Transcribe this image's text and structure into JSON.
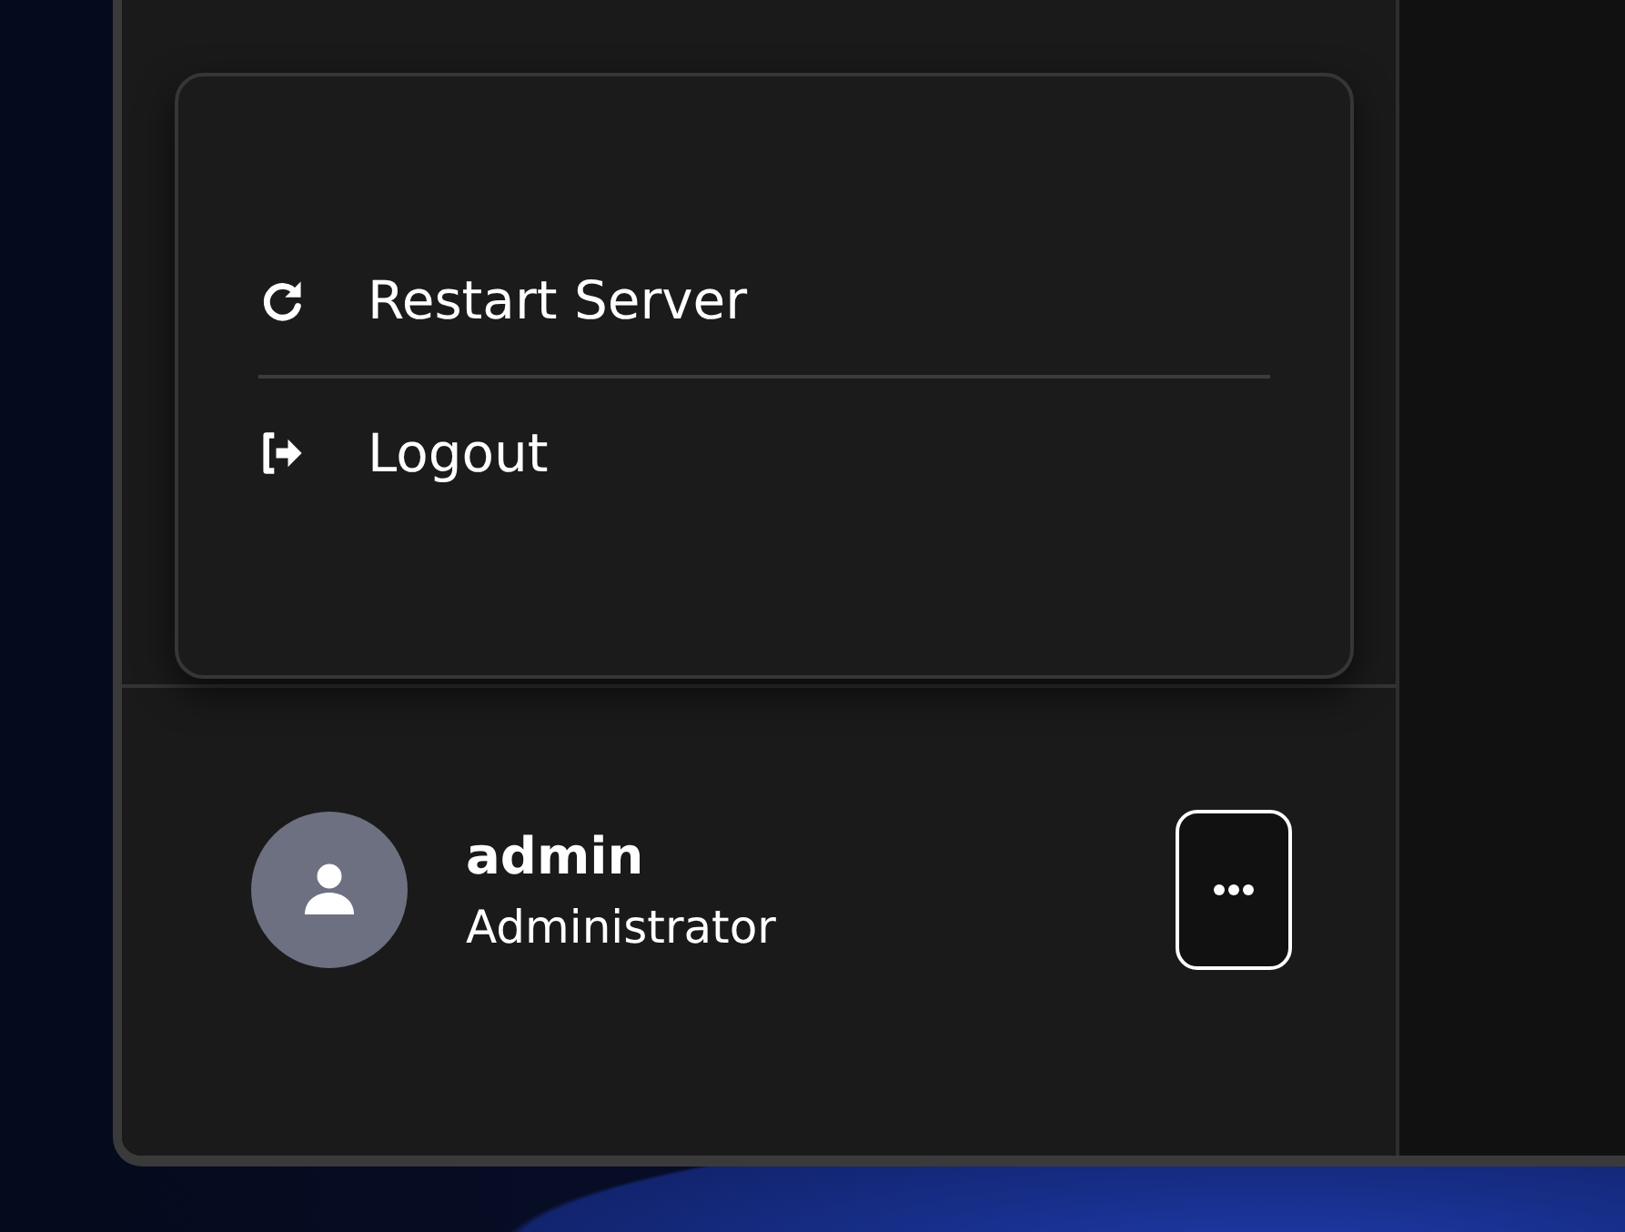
{
  "menu": {
    "items": [
      {
        "kind": "restart",
        "label": "Restart Server"
      },
      {
        "kind": "logout",
        "label": "Logout"
      }
    ]
  },
  "user": {
    "name": "admin",
    "role": "Administrator"
  }
}
